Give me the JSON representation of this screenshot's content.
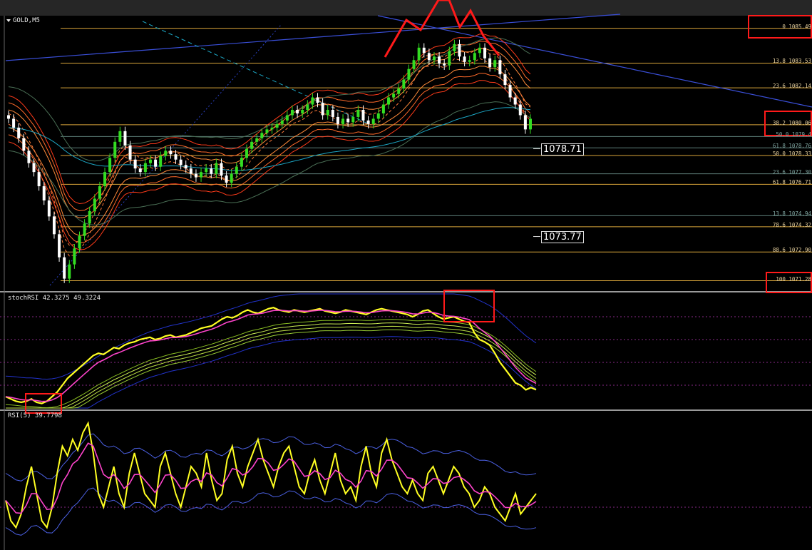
{
  "symbol_label": "GOLD,M5",
  "stoch_label": "stochRSI 42.3275 49.3224",
  "rsi_label": "RSI(5) 39.7798",
  "colors": {
    "background": "#000000",
    "bull_candle": "#33dd22",
    "bear_candle": "#ffffff",
    "fib_level": "#d9a53a",
    "fib_level_alt": "#5e7f7a",
    "highlight_box": "#ff1a1a",
    "pink_line": "#ff44cc",
    "yellow_line": "#ffff22",
    "blue_band": "#2233cc",
    "cyan_ma": "#1ca6c4"
  },
  "chart_data": {
    "type": "candlestick",
    "ylim": [
      1070.7,
      1086.2
    ],
    "price_tags": [
      {
        "label": "1078.71",
        "value": 1078.71
      },
      {
        "label": "1073.77",
        "value": 1073.77
      }
    ],
    "fib_levels": [
      {
        "label": "0 1085.49",
        "value": 1085.49,
        "color": "#d9a53a"
      },
      {
        "label": "13.8 1083.53",
        "value": 1083.53,
        "color": "#d9a53a"
      },
      {
        "label": "23.6 1082.14",
        "value": 1082.14,
        "color": "#d9a53a"
      },
      {
        "label": "38.2 1080.06",
        "value": 1080.06,
        "color": "#d9a53a"
      },
      {
        "label": "50.0 1079.4",
        "value": 1079.4,
        "color": "#5e7f7a"
      },
      {
        "label": "61.8 1078.76",
        "value": 1078.76,
        "color": "#5e7f7a"
      },
      {
        "label": "50.0 1078.33",
        "value": 1078.33,
        "color": "#d9a53a"
      },
      {
        "label": "23.6 1077.30",
        "value": 1077.3,
        "color": "#5e7f7a"
      },
      {
        "label": "61.8 1076.71",
        "value": 1076.71,
        "color": "#d9a53a"
      },
      {
        "label": "13.8 1074.94",
        "value": 1074.94,
        "color": "#5e7f7a"
      },
      {
        "label": "78.6 1074.32",
        "value": 1074.32,
        "color": "#d9a53a"
      },
      {
        "label": "88.6 1072.90",
        "value": 1072.9,
        "color": "#d9a53a"
      },
      {
        "label": "100 1071.28",
        "value": 1071.28,
        "color": "#d9a53a"
      }
    ],
    "closes": [
      1080.4,
      1079.9,
      1079.3,
      1078.6,
      1077.9,
      1077.4,
      1076.6,
      1075.8,
      1074.9,
      1073.9,
      1072.6,
      1071.4,
      1072.2,
      1073.1,
      1073.8,
      1074.5,
      1075.2,
      1075.9,
      1076.6,
      1077.4,
      1078.2,
      1079.1,
      1079.7,
      1078.9,
      1078.1,
      1077.6,
      1077.4,
      1077.9,
      1078.1,
      1077.7,
      1078.3,
      1078.6,
      1078.4,
      1078.1,
      1077.8,
      1077.6,
      1077.3,
      1077.1,
      1077.4,
      1077.6,
      1077.3,
      1077.9,
      1077.2,
      1076.8,
      1077.3,
      1077.7,
      1078.2,
      1078.7,
      1079.1,
      1079.3,
      1079.6,
      1079.8,
      1079.9,
      1080.1,
      1080.3,
      1080.6,
      1080.9,
      1080.7,
      1080.9,
      1081.2,
      1081.6,
      1081.3,
      1080.6,
      1080.9,
      1080.5,
      1080.1,
      1080.4,
      1080.2,
      1080.5,
      1080.9,
      1080.3,
      1080.1,
      1080.4,
      1080.7,
      1081.2,
      1081.6,
      1081.8,
      1082.1,
      1082.6,
      1083.2,
      1083.7,
      1084.4,
      1084.1,
      1083.7,
      1083.9,
      1083.5,
      1083.4,
      1084.2,
      1084.6,
      1083.9,
      1083.6,
      1083.7,
      1084.1,
      1084.4,
      1083.8,
      1083.3,
      1083.7,
      1082.9,
      1082.3,
      1081.6,
      1081.2,
      1080.6,
      1079.8,
      1080.4
    ],
    "stoch_rsi": {
      "ylim": [
        0,
        100
      ],
      "k": [
        10,
        8,
        6,
        5,
        6,
        8,
        5,
        4,
        6,
        10,
        14,
        20,
        26,
        30,
        34,
        38,
        42,
        46,
        48,
        47,
        50,
        53,
        52,
        55,
        57,
        58,
        60,
        61,
        62,
        60,
        61,
        63,
        64,
        62,
        63,
        64,
        66,
        68,
        70,
        71,
        72,
        75,
        78,
        80,
        79,
        81,
        84,
        86,
        84,
        83,
        85,
        87,
        88,
        86,
        85,
        84,
        86,
        85,
        84,
        85,
        86,
        87,
        85,
        84,
        83,
        84,
        86,
        85,
        84,
        83,
        82,
        84,
        86,
        87,
        86,
        85,
        84,
        83,
        82,
        80,
        82,
        85,
        86,
        83,
        80,
        78,
        79,
        80,
        78,
        76,
        75,
        66,
        60,
        58,
        55,
        48,
        40,
        34,
        28,
        22,
        20,
        16,
        18,
        16
      ]
    },
    "rsi": {
      "ylim": [
        0,
        100
      ],
      "values": [
        35,
        20,
        15,
        25,
        45,
        60,
        40,
        20,
        15,
        30,
        55,
        75,
        68,
        80,
        72,
        85,
        92,
        70,
        40,
        30,
        45,
        60,
        40,
        30,
        55,
        70,
        55,
        40,
        35,
        30,
        60,
        70,
        55,
        40,
        30,
        45,
        60,
        55,
        45,
        70,
        50,
        35,
        40,
        65,
        75,
        55,
        45,
        60,
        70,
        80,
        65,
        55,
        45,
        60,
        70,
        75,
        60,
        45,
        40,
        55,
        65,
        50,
        40,
        55,
        70,
        50,
        40,
        45,
        35,
        60,
        75,
        55,
        45,
        70,
        80,
        65,
        55,
        45,
        40,
        50,
        40,
        35,
        55,
        60,
        50,
        40,
        50,
        60,
        55,
        45,
        40,
        30,
        35,
        45,
        40,
        30,
        25,
        20,
        30,
        40,
        25,
        30,
        35,
        40
      ]
    }
  }
}
